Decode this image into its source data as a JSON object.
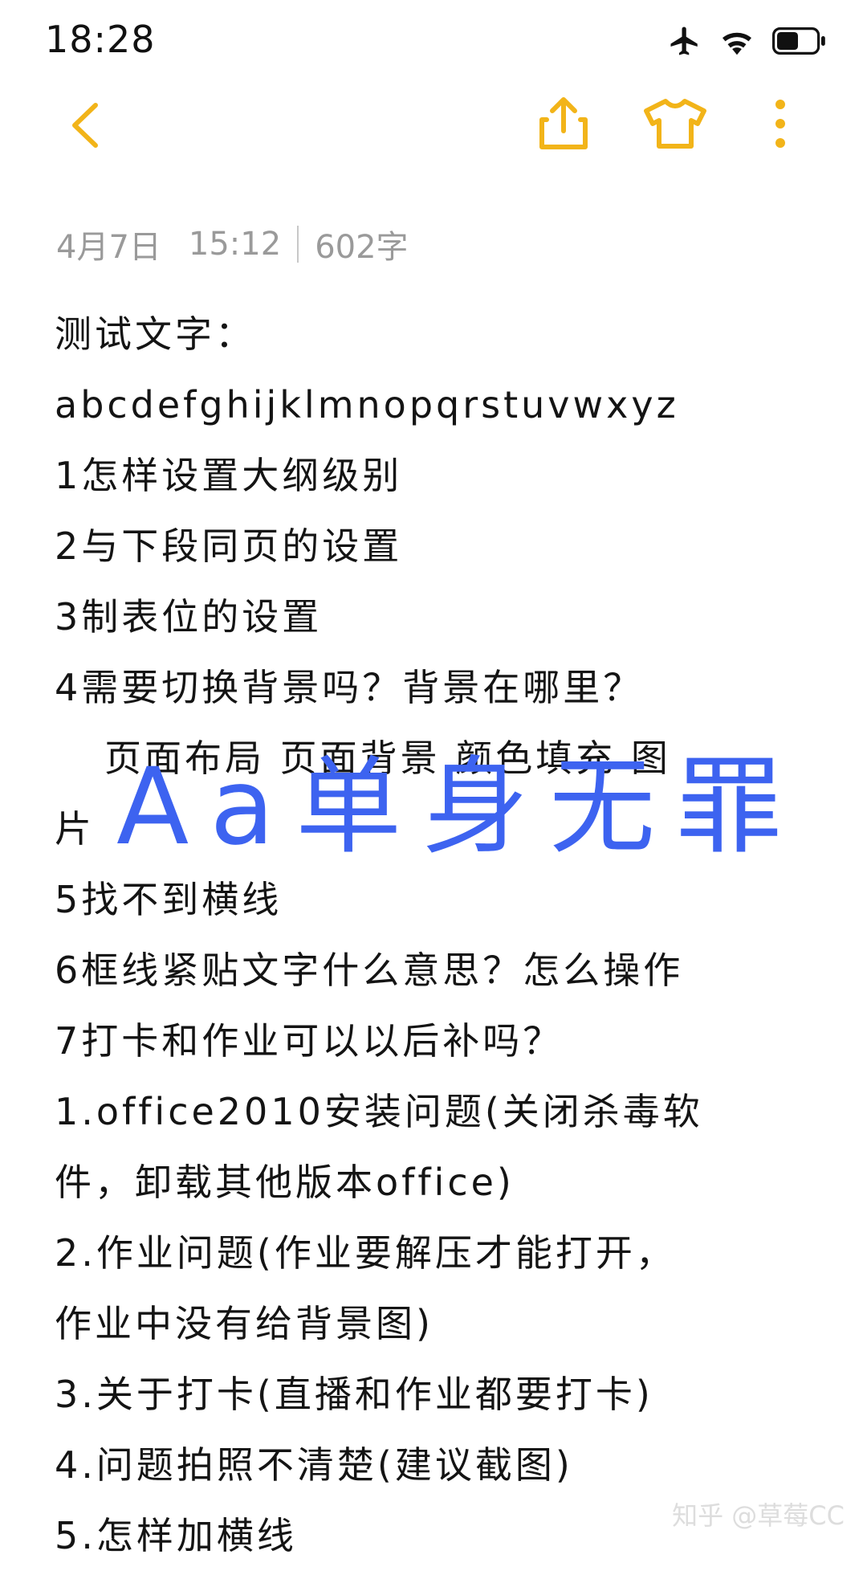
{
  "status_bar": {
    "time": "18:28",
    "icons": [
      "airplane-icon",
      "wifi-icon",
      "battery-icon"
    ]
  },
  "toolbar": {
    "accent_color": "#F2B419",
    "icons": [
      "back-icon",
      "share-icon",
      "tshirt-icon",
      "more-icon"
    ]
  },
  "note": {
    "meta": {
      "date": "4月7日",
      "time": "15:12",
      "word_count": "602字"
    },
    "lines": [
      "测试文字：",
      "abcdefghijklmnopqrstuvwxyz",
      "1怎样设置大纲级别",
      "2与下段同页的设置",
      "3制表位的设置",
      "4需要切换背景吗？背景在哪里？",
      "页面布局 页面背景 颜色填充 图",
      "片",
      "5找不到横线",
      "6框线紧贴文字什么意思？怎么操作",
      "7打卡和作业可以以后补吗？",
      "1.office2010安装问题(关闭杀毒软",
      "件，卸载其他版本office)",
      "2.作业问题(作业要解压才能打开，",
      "作业中没有给背景图)",
      "3.关于打卡(直播和作业都要打卡)",
      "4.问题拍照不清楚(建议截图)",
      "5.怎样加横线"
    ]
  },
  "overlay": {
    "text": "Aa单身无罪",
    "color": "#3D63F0"
  },
  "watermark": "知乎 @草莓CC"
}
